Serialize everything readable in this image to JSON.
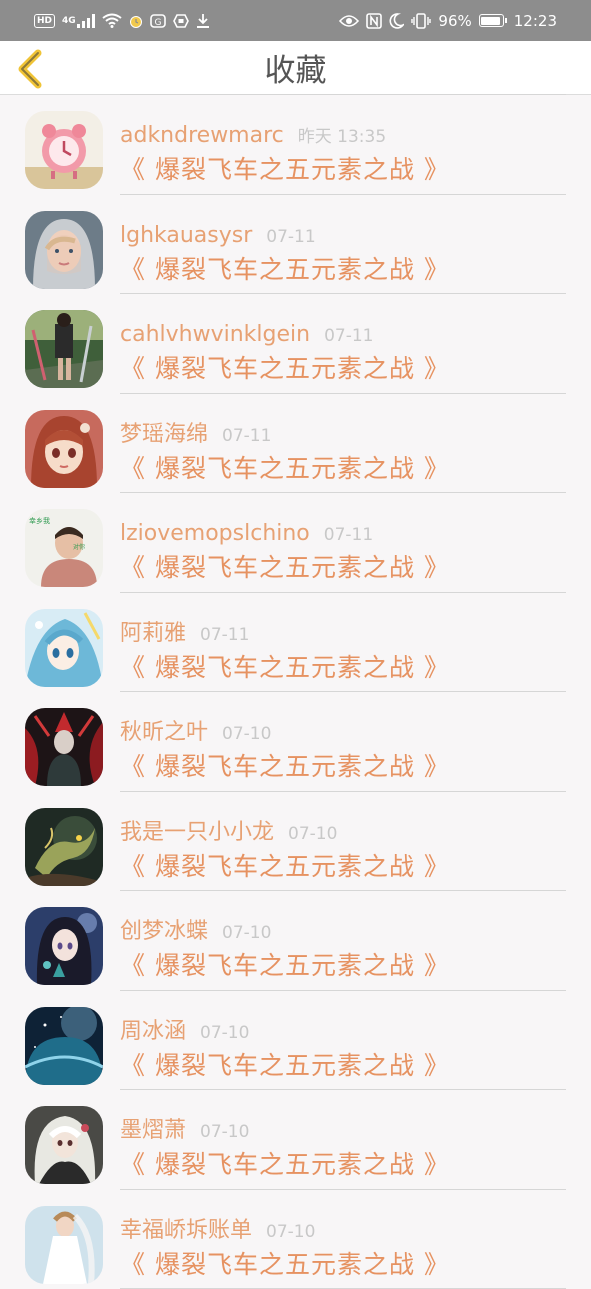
{
  "status_bar": {
    "left_icons": [
      "hd-icon",
      "4g-signal-icon",
      "wifi-icon",
      "alarm-icon",
      "app-notification-icon",
      "shield-notification-icon",
      "download-icon"
    ],
    "hd_label": "HD",
    "network_label": "4G",
    "battery_percent": "96%",
    "battery_level": 0.96,
    "time": "12:23",
    "right_icons": [
      "eye-icon",
      "nfc-icon",
      "moon-icon",
      "vibrate-icon",
      "battery-icon"
    ]
  },
  "header": {
    "title": "收藏",
    "back_icon": "chevron-left-icon",
    "accent_color": "#f0c437"
  },
  "colors": {
    "username": "#e7a173",
    "book_title": "#e69261",
    "timestamp": "#c8c8c8"
  },
  "favorites": [
    {
      "username": "adkndrewmarc",
      "time": "昨天 13:35",
      "book": "《 爆裂飞车之五元素之战 》",
      "avatar": "pink-alarm-clock-avatar"
    },
    {
      "username": "lghkauasysr",
      "time": "07-11",
      "book": "《 爆裂飞车之五元素之战 》",
      "avatar": "hooded-girl-avatar"
    },
    {
      "username": "cahlvhwvinklgein",
      "time": "07-11",
      "book": "《 爆裂飞车之五元素之战 》",
      "avatar": "street-person-avatar"
    },
    {
      "username": "梦瑶海绵",
      "time": "07-11",
      "book": "《 爆裂飞车之五元素之战 》",
      "avatar": "anime-girl-red-avatar"
    },
    {
      "username": "lziovemopslchino",
      "time": "07-11",
      "book": "《 爆裂飞车之五元素之战 》",
      "avatar": "boy-portrait-avatar"
    },
    {
      "username": "阿莉雅",
      "time": "07-11",
      "book": "《 爆裂飞车之五元素之战 》",
      "avatar": "anime-blue-avatar"
    },
    {
      "username": "秋昕之叶",
      "time": "07-10",
      "book": "《 爆裂飞车之五元素之战 》",
      "avatar": "dark-warrior-avatar"
    },
    {
      "username": "我是一只小小龙",
      "time": "07-10",
      "book": "《 爆裂飞车之五元素之战 》",
      "avatar": "dragon-avatar"
    },
    {
      "username": "创梦冰蝶",
      "time": "07-10",
      "book": "《 爆裂飞车之五元素之战 》",
      "avatar": "anime-dark-hair-avatar"
    },
    {
      "username": "周冰涵",
      "time": "07-10",
      "book": "《 爆裂飞车之五元素之战 》",
      "avatar": "planet-avatar"
    },
    {
      "username": "墨熠萧",
      "time": "07-10",
      "book": "《 爆裂飞车之五元素之战 》",
      "avatar": "white-hair-avatar"
    },
    {
      "username": "幸福峤坼账单",
      "time": "07-10",
      "book": "《 爆裂飞车之五元素之战 》",
      "avatar": "bride-avatar"
    }
  ]
}
